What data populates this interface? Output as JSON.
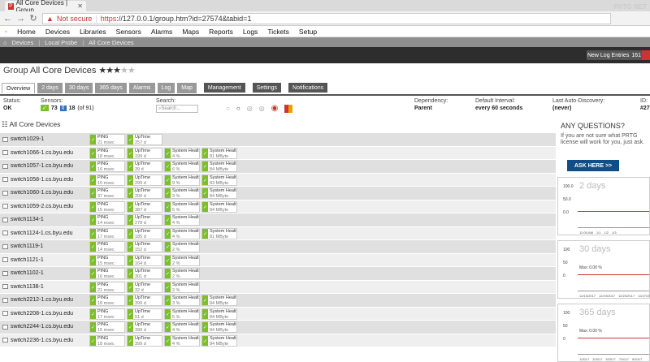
{
  "browser": {
    "tab_title": "All Core Devices | Group",
    "warning": "Not secure",
    "url_proto": "https",
    "url_rest": "://127.0.0.1/group.htm?id=27574&tabid=1"
  },
  "menu": [
    "Home",
    "Devices",
    "Libraries",
    "Sensors",
    "Alarms",
    "Maps",
    "Reports",
    "Logs",
    "Tickets",
    "Setup"
  ],
  "breadcrumbs": [
    "Devices",
    "Local Probe",
    "All Core Devices"
  ],
  "brand": "PRTG NET",
  "new_log": {
    "label": "New Log Entries",
    "count": "161"
  },
  "title": {
    "prefix": "Group",
    "name": "All Core Devices",
    "stars_on": "★★★",
    "stars_off": "★★"
  },
  "tabs": [
    "Overview",
    "2 days",
    "30 days",
    "365 days",
    "Alarms",
    "Log",
    "Map"
  ],
  "actions": [
    "Management",
    "Settings",
    "Notifications"
  ],
  "status": {
    "status_label": "Status:",
    "status_value": "OK",
    "sensors_label": "Sensors:",
    "sensors_up": "73",
    "sensors_paused": "18",
    "sensors_total": "(of 91)",
    "search_label": "Search:",
    "search_placeholder": "Search...",
    "dependency_label": "Dependency:",
    "dependency_value": "Parent",
    "interval_label": "Default Interval:",
    "interval_value": "every 60 seconds",
    "discovery_label": "Last Auto-Discovery:",
    "discovery_value": "(never)",
    "id_label": "ID:",
    "id_value": "#27"
  },
  "tree_title": "All Core Devices",
  "devices": [
    {
      "name": "switch1029-1",
      "sensors": [
        [
          "PING",
          "21 msec"
        ],
        [
          "UpTime",
          "257 d"
        ]
      ]
    },
    {
      "name": "switch1066-1.cs.byu.edu",
      "sensors": [
        [
          "PING",
          "18 msec"
        ],
        [
          "UpTime",
          "199 d"
        ],
        [
          "System Healt...",
          "4 %"
        ],
        [
          "System Healt...",
          "81 MByte"
        ]
      ]
    },
    {
      "name": "switch1057-1.cs.byu.edu",
      "sensors": [
        [
          "PING",
          "16 msec"
        ],
        [
          "UpTime",
          "39 d"
        ],
        [
          "System Healt...",
          "6 %"
        ],
        [
          "System Healt...",
          "84 MByte"
        ]
      ]
    },
    {
      "name": "switch1058-1.cs.byu.edu",
      "sensors": [
        [
          "PING",
          "15 msec"
        ],
        [
          "UpTime",
          "299 d"
        ],
        [
          "System Healt...",
          "9 %"
        ],
        [
          "System Healt...",
          "83 MByte"
        ]
      ]
    },
    {
      "name": "switch1060-1.cs.byu.edu",
      "sensors": [
        [
          "PING",
          "37 msec"
        ],
        [
          "UpTime",
          "200 d"
        ],
        [
          "System Healt...",
          "3 %"
        ],
        [
          "System Healt...",
          "84 MByte"
        ]
      ]
    },
    {
      "name": "switch1059-2.cs.byu.edu",
      "sensors": [
        [
          "PING",
          "15 msec"
        ],
        [
          "UpTime",
          "387 d"
        ],
        [
          "System Healt...",
          "5 %"
        ],
        [
          "System Healt...",
          "84 MByte"
        ]
      ]
    },
    {
      "name": "switch1134-1",
      "sensors": [
        [
          "PING",
          "14 msec"
        ],
        [
          "UpTime",
          "278 d"
        ],
        [
          "System Healt...",
          "4 %"
        ]
      ]
    },
    {
      "name": "switch1124-1.cs.byu.edu",
      "sensors": [
        [
          "PING",
          "17 msec"
        ],
        [
          "UpTime",
          "185 d"
        ],
        [
          "System Healt...",
          "4 %"
        ],
        [
          "System Healt...",
          "81 MByte"
        ]
      ]
    },
    {
      "name": "switch1119-1",
      "sensors": [
        [
          "PING",
          "14 msec"
        ],
        [
          "UpTime",
          "152 d"
        ],
        [
          "System Healt...",
          "2 %"
        ]
      ]
    },
    {
      "name": "switch1121-1",
      "sensors": [
        [
          "PING",
          "15 msec"
        ],
        [
          "UpTime",
          "164 d"
        ],
        [
          "System Healt...",
          "2 %"
        ]
      ]
    },
    {
      "name": "switch1102-1",
      "sensors": [
        [
          "PING",
          "16 msec"
        ],
        [
          "UpTime",
          "301 d"
        ],
        [
          "System Healt...",
          "2 %"
        ]
      ]
    },
    {
      "name": "switch1138-1",
      "sensors": [
        [
          "PING",
          "21 msec"
        ],
        [
          "UpTime",
          "32 d"
        ],
        [
          "System Healt...",
          "2 %"
        ]
      ]
    },
    {
      "name": "switch2212-1.cs.byu.edu",
      "sensors": [
        [
          "PING",
          "18 msec"
        ],
        [
          "UpTime",
          "399 d"
        ],
        [
          "System Healt...",
          "3 %"
        ],
        [
          "System Healt...",
          "84 MByte"
        ]
      ]
    },
    {
      "name": "switch2208-1.cs.byu.edu",
      "sensors": [
        [
          "PING",
          "17 msec"
        ],
        [
          "UpTime",
          "51 d"
        ],
        [
          "System Healt...",
          "5 %"
        ],
        [
          "System Healt...",
          "84 MByte"
        ]
      ]
    },
    {
      "name": "switch2244-1.cs.byu.edu",
      "sensors": [
        [
          "PING",
          "15 msec"
        ],
        [
          "UpTime",
          "399 d"
        ],
        [
          "System Healt...",
          "4 %"
        ],
        [
          "System Healt...",
          "84 MByte"
        ]
      ]
    },
    {
      "name": "switch2236-1.cs.byu.edu",
      "sensors": [
        [
          "PING",
          "18 msec"
        ],
        [
          "UpTime",
          "399 d"
        ],
        [
          "System Healt...",
          "4 %"
        ],
        [
          "System Healt...",
          "84 MByte"
        ]
      ]
    }
  ],
  "panel": {
    "heading": "ANY QUESTIONS?",
    "text": "If you are not sure what PRTG license will work for you, just ask.",
    "button": "ASK HERE >>"
  },
  "charts": [
    {
      "title": "2 days",
      "y_top": "100.0",
      "y_mid": "50.0",
      "y_bot": "0.0",
      "max": "",
      "ticks": [
        "12:00 AM",
        "1/1",
        "1/2",
        "1/3"
      ]
    },
    {
      "title": "30 days",
      "y_top": "100",
      "y_mid": "50",
      "y_bot": "0",
      "max": "Max: 0.00 %",
      "ticks": [
        "12/15/2017",
        "12/19/2017",
        "12/23/2017",
        "12/27/2017",
        "12/31/2017"
      ]
    },
    {
      "title": "365 days",
      "y_top": "100",
      "y_mid": "50",
      "y_bot": "0",
      "max": "Max: 0.00 %",
      "ticks": [
        "1/2017",
        "3/2017",
        "5/2017",
        "7/2017",
        "9/2017"
      ]
    }
  ]
}
